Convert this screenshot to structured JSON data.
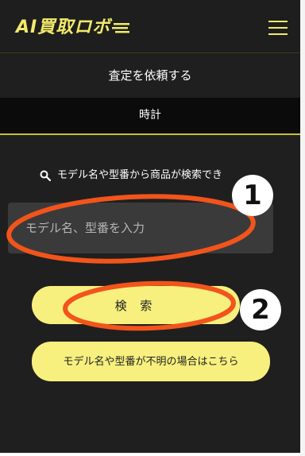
{
  "header": {
    "logo_text": "AI買取ロボ",
    "menu_icon": "hamburger-menu-icon"
  },
  "page_title": "査定を依頼する",
  "tab": {
    "label": "時計"
  },
  "search": {
    "hint": "モデル名や型番から商品が検索でき",
    "placeholder": "モデル名、型番を入力",
    "button_label": "検 索",
    "unknown_label": "モデル名や型番が不明の場合はこちら"
  },
  "annotations": [
    {
      "number": "1"
    },
    {
      "number": "2"
    }
  ],
  "colors": {
    "accent_yellow": "#f7f07e",
    "background": "#1f1f1f",
    "annotation_orange": "#f2541b"
  }
}
